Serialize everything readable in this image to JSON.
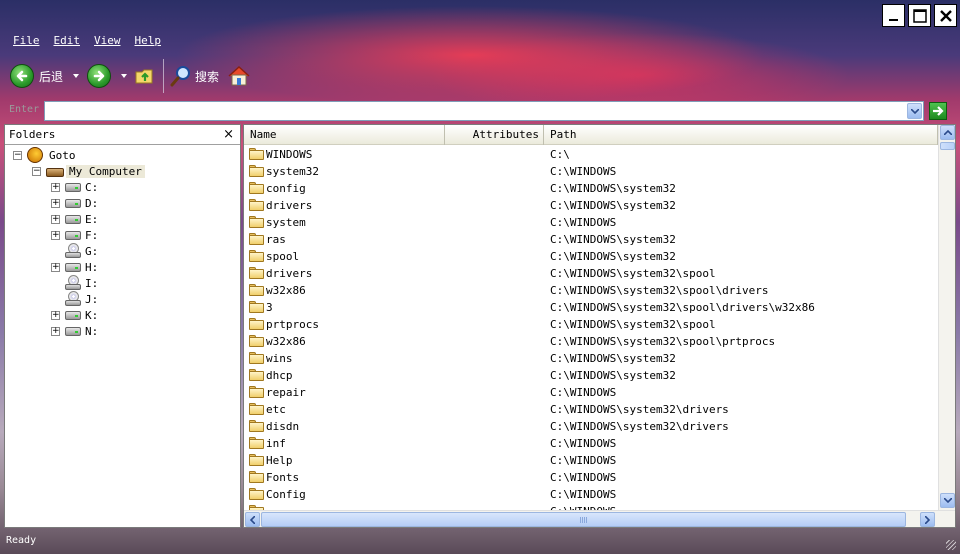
{
  "window": {
    "controls": [
      {
        "name": "minimize-button",
        "icon": "minimize-icon"
      },
      {
        "name": "maximize-button",
        "icon": "maximize-icon"
      },
      {
        "name": "close-button",
        "icon": "close-icon"
      }
    ]
  },
  "menu": [
    "File",
    "Edit",
    "View",
    "Help"
  ],
  "toolbar": {
    "back_label": "后退",
    "search_label": "搜索"
  },
  "address": {
    "label": "Enter",
    "value": ""
  },
  "folders_pane": {
    "title": "Folders",
    "close_glyph": "×",
    "root": "Goto",
    "computer": "My Computer",
    "drives": [
      "C:",
      "D:",
      "E:",
      "F:",
      "G:",
      "H:",
      "I:",
      "J:",
      "K:",
      "N:"
    ]
  },
  "list": {
    "columns": [
      "Name",
      "Attributes",
      "Path"
    ],
    "rows": [
      {
        "name": "WINDOWS",
        "path": "C:\\"
      },
      {
        "name": "system32",
        "path": "C:\\WINDOWS"
      },
      {
        "name": "config",
        "path": "C:\\WINDOWS\\system32"
      },
      {
        "name": "drivers",
        "path": "C:\\WINDOWS\\system32"
      },
      {
        "name": "system",
        "path": "C:\\WINDOWS"
      },
      {
        "name": "ras",
        "path": "C:\\WINDOWS\\system32"
      },
      {
        "name": "spool",
        "path": "C:\\WINDOWS\\system32"
      },
      {
        "name": "drivers",
        "path": "C:\\WINDOWS\\system32\\spool"
      },
      {
        "name": "w32x86",
        "path": "C:\\WINDOWS\\system32\\spool\\drivers"
      },
      {
        "name": "3",
        "path": "C:\\WINDOWS\\system32\\spool\\drivers\\w32x86"
      },
      {
        "name": "prtprocs",
        "path": "C:\\WINDOWS\\system32\\spool"
      },
      {
        "name": "w32x86",
        "path": "C:\\WINDOWS\\system32\\spool\\prtprocs"
      },
      {
        "name": "wins",
        "path": "C:\\WINDOWS\\system32"
      },
      {
        "name": "dhcp",
        "path": "C:\\WINDOWS\\system32"
      },
      {
        "name": "repair",
        "path": "C:\\WINDOWS"
      },
      {
        "name": "etc",
        "path": "C:\\WINDOWS\\system32\\drivers"
      },
      {
        "name": "disdn",
        "path": "C:\\WINDOWS\\system32\\drivers"
      },
      {
        "name": "inf",
        "path": "C:\\WINDOWS"
      },
      {
        "name": "Help",
        "path": "C:\\WINDOWS"
      },
      {
        "name": "Fonts",
        "path": "C:\\WINDOWS"
      },
      {
        "name": "Config",
        "path": "C:\\WINDOWS"
      },
      {
        "name": "",
        "path": "C:\\WINDOWS"
      }
    ]
  },
  "status": {
    "text": "Ready"
  },
  "colors": {
    "accent": "#2a9a2a",
    "folder": "#f0cf6a",
    "scroll": "#9cbcf0"
  }
}
